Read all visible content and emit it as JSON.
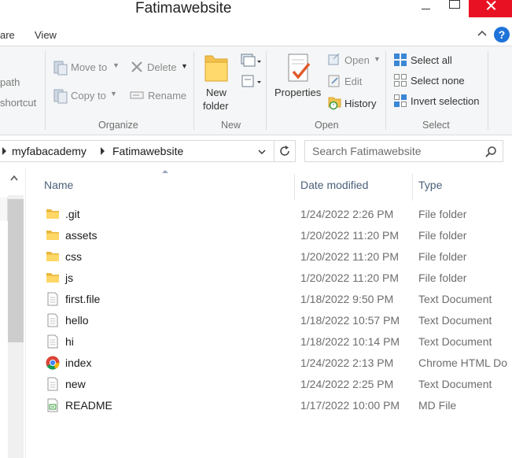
{
  "window": {
    "title": "Fatimawebsite"
  },
  "ribbon_tabs": [
    "are",
    "View"
  ],
  "ribbon": {
    "clipboard_partial": {
      "path_label": "path",
      "shortcut_label": "shortcut"
    },
    "organize": {
      "move_to": "Move to",
      "copy_to": "Copy to",
      "delete": "Delete",
      "rename": "Rename",
      "group": "Organize"
    },
    "new": {
      "new_folder_line1": "New",
      "new_folder_line2": "folder",
      "group": "New"
    },
    "open": {
      "properties": "Properties",
      "open": "Open",
      "edit": "Edit",
      "history": "History",
      "group": "Open"
    },
    "select": {
      "select_all": "Select all",
      "select_none": "Select none",
      "invert_selection": "Invert selection",
      "group": "Select"
    }
  },
  "address": {
    "crumbs": [
      "myfabacademy",
      "Fatimawebsite"
    ],
    "search_placeholder": "Search Fatimawebsite"
  },
  "columns": {
    "name": "Name",
    "date": "Date modified",
    "type": "Type"
  },
  "files": [
    {
      "name": ".git",
      "date": "1/24/2022 2:26 PM",
      "type": "File folder",
      "icon": "folder-icon"
    },
    {
      "name": "assets",
      "date": "1/20/2022 11:20 PM",
      "type": "File folder",
      "icon": "folder-icon"
    },
    {
      "name": "css",
      "date": "1/20/2022 11:20 PM",
      "type": "File folder",
      "icon": "folder-icon"
    },
    {
      "name": "js",
      "date": "1/20/2022 11:20 PM",
      "type": "File folder",
      "icon": "folder-icon"
    },
    {
      "name": "first.file",
      "date": "1/18/2022 9:50 PM",
      "type": "Text Document",
      "icon": "document-icon"
    },
    {
      "name": "hello",
      "date": "1/18/2022 10:57 PM",
      "type": "Text Document",
      "icon": "document-icon"
    },
    {
      "name": "hi",
      "date": "1/18/2022 10:14 PM",
      "type": "Text Document",
      "icon": "document-icon"
    },
    {
      "name": "index",
      "date": "1/24/2022 2:13 PM",
      "type": "Chrome HTML Do",
      "icon": "chrome-icon"
    },
    {
      "name": "new",
      "date": "1/24/2022 2:25 PM",
      "type": "Text Document",
      "icon": "document-icon"
    },
    {
      "name": "README",
      "date": "1/17/2022 10:00 PM",
      "type": "MD File",
      "icon": "md-document-icon"
    }
  ]
}
